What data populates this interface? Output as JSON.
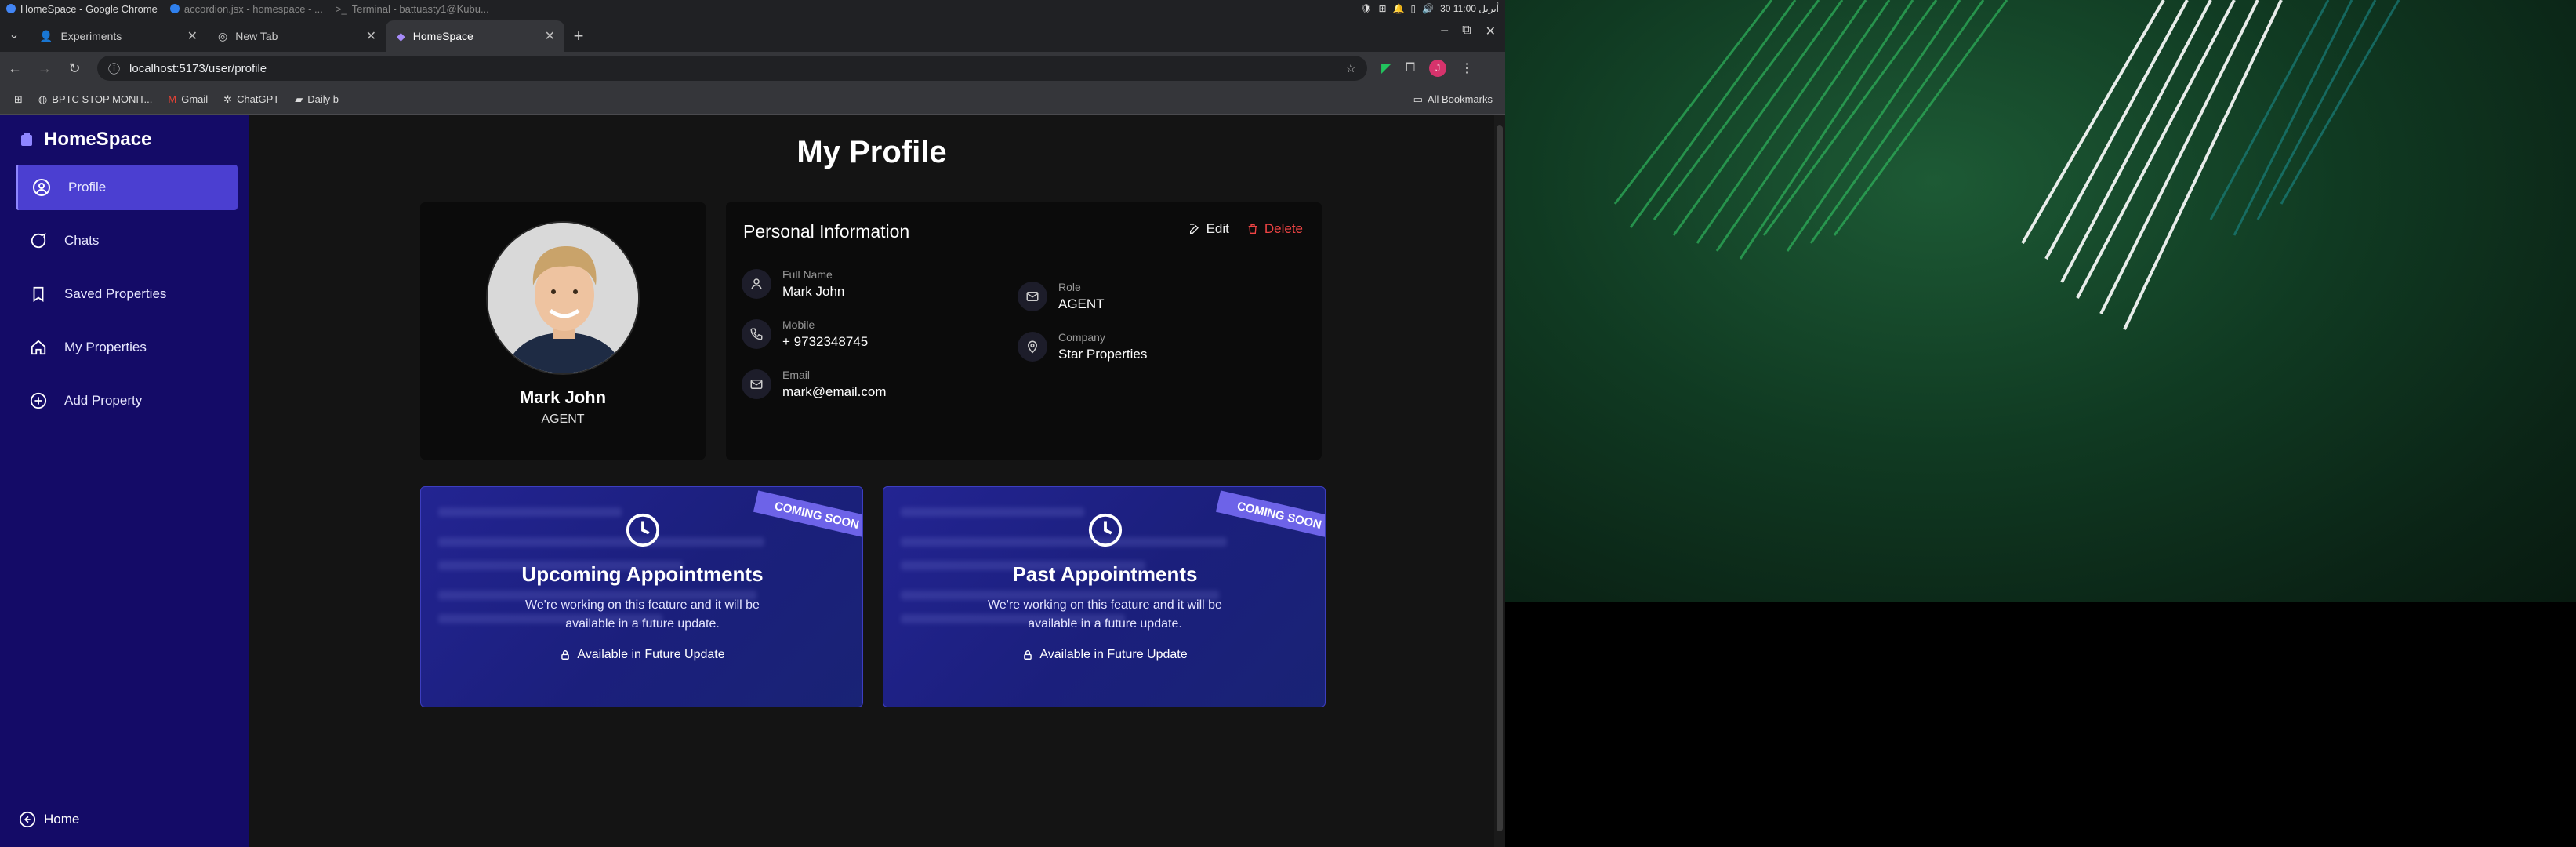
{
  "system": {
    "items": [
      "HomeSpace - Google Chrome",
      "accordion.jsx - homespace - ...",
      "Terminal - battuasty1@Kubu..."
    ],
    "clock": "30 أبريل 11:00"
  },
  "browser": {
    "tabs": [
      {
        "title": "Experiments"
      },
      {
        "title": "New Tab"
      },
      {
        "title": "HomeSpace"
      }
    ],
    "url": "localhost:5173/user/profile",
    "profile_initial": "J",
    "bookmarks": [
      "BPTC STOP MONIT...",
      "Gmail",
      "ChatGPT",
      "Daily b"
    ],
    "all_bookmarks": "All Bookmarks"
  },
  "sidebar": {
    "brand": "HomeSpace",
    "items": [
      {
        "label": "Profile"
      },
      {
        "label": "Chats"
      },
      {
        "label": "Saved Properties"
      },
      {
        "label": "My Properties"
      },
      {
        "label": "Add Property"
      }
    ],
    "home": "Home"
  },
  "page": {
    "title": "My Profile",
    "profile": {
      "name": "Mark John",
      "role": "AGENT"
    },
    "info": {
      "title": "Personal Information",
      "edit": "Edit",
      "delete": "Delete",
      "fields": [
        {
          "label": "Full Name",
          "value": "Mark John"
        },
        {
          "label": "Mobile",
          "value": "+ 9732348745"
        },
        {
          "label": "Email",
          "value": "mark@email.com"
        },
        {
          "label": "Role",
          "value": "AGENT"
        },
        {
          "label": "Company",
          "value": "Star Properties"
        }
      ]
    },
    "appointments": [
      {
        "title": "Upcoming Appointments",
        "ribbon": "COMING SOON",
        "desc": "We're working on this feature and it will be available in a future update.",
        "footer": "Available in Future Update"
      },
      {
        "title": "Past Appointments",
        "ribbon": "COMING SOON",
        "desc": "We're working on this feature and it will be available in a future update.",
        "footer": "Available in Future Update"
      }
    ]
  },
  "colors": {
    "sidebar": "#140b67",
    "accent": "#4b3fd1",
    "danger": "#ef4444",
    "ribbon": "#6d63e8"
  }
}
